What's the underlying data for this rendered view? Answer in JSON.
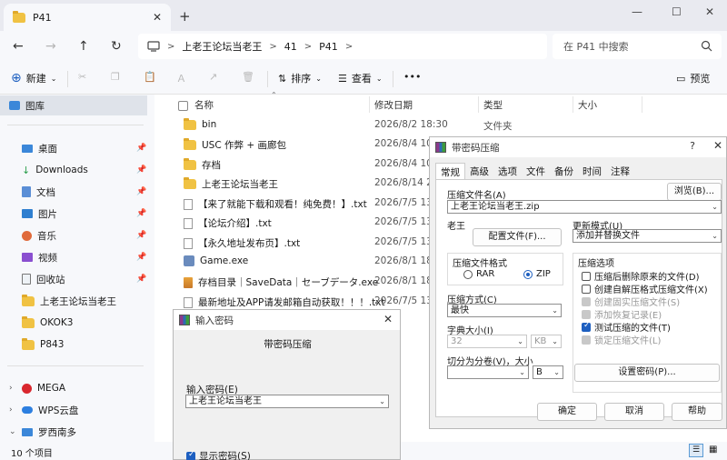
{
  "tab": {
    "title": "P41",
    "close": "✕",
    "new": "+"
  },
  "window": {
    "minimize": "—",
    "maximize": "☐",
    "close": "✕"
  },
  "nav": {
    "back": "←",
    "forward": "→",
    "up": "↑",
    "refresh": "↻"
  },
  "breadcrumb": {
    "c1": "上老王论坛当老王",
    "c2": "41",
    "c3": "P41",
    "sep": ">"
  },
  "search": {
    "placeholder": "在 P41 中搜索"
  },
  "toolbar": {
    "new": "新建",
    "sort": "排序",
    "view": "查看",
    "more": "•••",
    "preview": "预览"
  },
  "sidebar": {
    "gallery": "图库",
    "desktop": "桌面",
    "downloads": "Downloads",
    "documents": "文档",
    "pictures": "图片",
    "music": "音乐",
    "videos": "视频",
    "recycle": "回收站",
    "f1": "上老王论坛当老王",
    "f2": "OKOK3",
    "f3": "P843",
    "mega": "MEGA",
    "wps": "WPS云盘",
    "luoxi": "罗西南多"
  },
  "status": {
    "count": "10 个项目"
  },
  "columns": {
    "name": "名称",
    "date": "修改日期",
    "type": "类型",
    "size": "大小"
  },
  "files": [
    {
      "name": "bin",
      "date": "2026/8/2 18:30",
      "type": "文件夹"
    },
    {
      "name": "USC 作弊 + 画廊包",
      "date": "2026/8/4 10:4",
      "type": ""
    },
    {
      "name": "存档",
      "date": "2026/8/4 10:4",
      "type": ""
    },
    {
      "name": "上老王论坛当老王",
      "date": "2026/8/14 20",
      "type": ""
    },
    {
      "name": "【来了就能下载和观看！纯免费！】.txt",
      "date": "2026/7/5 13:1",
      "type": ""
    },
    {
      "name": "【论坛介绍】.txt",
      "date": "2026/7/5 13:1",
      "type": ""
    },
    {
      "name": "【永久地址发布页】.txt",
      "date": "2026/7/5 13:1",
      "type": ""
    },
    {
      "name": "Game.exe",
      "date": "2026/8/1 18:5",
      "type": ""
    },
    {
      "name": "存档目录｜SaveData｜セーブデータ.exe",
      "date": "2026/8/1 18:",
      "type": ""
    },
    {
      "name": "最新地址及APP请发邮箱自动获取！！！.txt",
      "date": "2026/7/5 13:1",
      "type": ""
    }
  ],
  "pwd_dialog": {
    "title": "输入密码",
    "close": "✕",
    "heading": "带密码压缩",
    "label": "输入密码(E)",
    "value": "上老王论坛当老王",
    "show": "显示密码(S)"
  },
  "arc_dialog": {
    "title": "带密码压缩",
    "help": "?",
    "close": "✕",
    "tabs": [
      "常规",
      "高级",
      "选项",
      "文件",
      "备份",
      "时间",
      "注释"
    ],
    "archive_name_label": "压缩文件名(A)",
    "browse": "浏览(B)...",
    "archive_name": "上老王论坛当老王.zip",
    "profile_label": "老王",
    "profiles_btn": "配置文件(F)...",
    "update_label": "更新模式(U)",
    "update_value": "添加并替换文件",
    "format_label": "压缩文件格式",
    "rar": "RAR",
    "zip": "ZIP",
    "options_label": "压缩选项",
    "opt1": "压缩后删除原来的文件(D)",
    "opt2": "创建自解压格式压缩文件(X)",
    "opt3": "创建固实压缩文件(S)",
    "opt4": "添加恢复记录(E)",
    "opt5": "测试压缩的文件(T)",
    "opt6": "锁定压缩文件(L)",
    "method_label": "压缩方式(C)",
    "method_value": "最快",
    "dict_label": "字典大小(I)",
    "dict_value": "32",
    "dict_unit": "KB",
    "split_label": "切分为分卷(V)，大小",
    "split_unit": "B",
    "set_pwd": "设置密码(P)...",
    "ok": "确定",
    "cancel": "取消",
    "help_btn": "帮助"
  }
}
